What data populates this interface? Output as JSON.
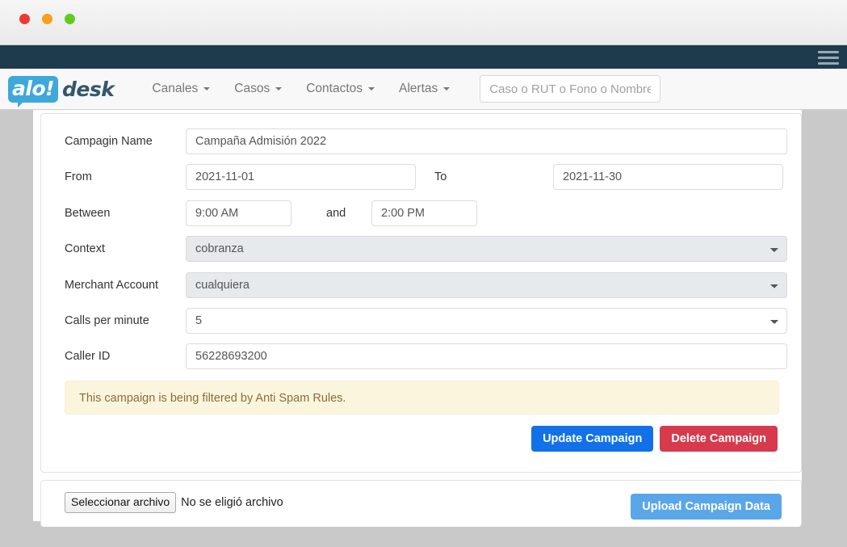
{
  "browser": {
    "traffic_lights": [
      "close",
      "minimize",
      "maximize"
    ],
    "menu_icon": "hamburger-icon"
  },
  "navbar": {
    "brand_badge": "alo!",
    "brand_word": "desk",
    "links": [
      {
        "label": "Canales"
      },
      {
        "label": "Casos"
      },
      {
        "label": "Contactos"
      },
      {
        "label": "Alertas"
      }
    ],
    "search": {
      "value": "",
      "placeholder": "Caso o RUT o Fono o Nombre"
    }
  },
  "form": {
    "campaign_name": {
      "label": "Campagin Name",
      "value": "Campaña Admisión 2022"
    },
    "from": {
      "label": "From",
      "value": "2021-11-01"
    },
    "to": {
      "label": "To",
      "value": "2021-11-30"
    },
    "between": {
      "label": "Between",
      "start_value": "9:00 AM",
      "joiner": "and",
      "end_value": "2:00 PM"
    },
    "context": {
      "label": "Context",
      "value": "cobranza",
      "options": [
        "cobranza"
      ]
    },
    "merchant_account": {
      "label": "Merchant Account",
      "value": "cualquiera",
      "options": [
        "cualquiera"
      ]
    },
    "calls_per_minute": {
      "label": "Calls per minute",
      "value": "5",
      "options": [
        "5"
      ]
    },
    "caller_id": {
      "label": "Caller ID",
      "value": "56228693200"
    },
    "alert": {
      "text": "This campaign is being filtered by Anti Spam Rules."
    },
    "buttons": {
      "update": "Update Campaign",
      "delete": "Delete Campaign"
    }
  },
  "upload": {
    "file_button": "Seleccionar archivo",
    "file_status": "No se eligió archivo",
    "upload_button": "Upload Campaign Data"
  },
  "colors": {
    "topbar": "#1d3b4d",
    "brand_blue": "#3ea8da",
    "primary": "#1271e8",
    "danger": "#d63a4c",
    "upload": "#5ba6e8",
    "alert_bg": "#fcf5dd",
    "alert_text": "#8a6d3b",
    "page_bg": "#c9c9c9"
  }
}
